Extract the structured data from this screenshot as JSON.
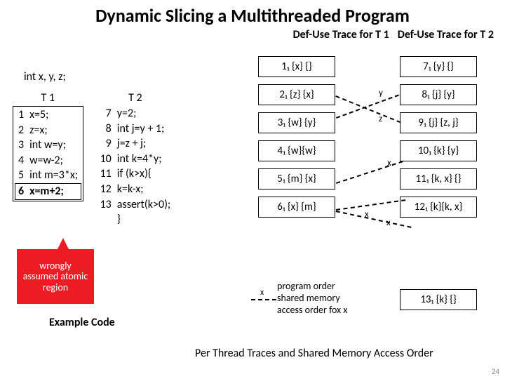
{
  "title": "Dynamic Slicing a Multithreaded Program",
  "subhead1": "Def-Use Trace for T 1",
  "subhead2": "Def-Use Trace for T 2",
  "decl": "int x, y, z;",
  "t1_title": "T 1",
  "t2_title": "T 2",
  "t1_lines": [
    {
      "n": "1",
      "c": "x=5;"
    },
    {
      "n": "2",
      "c": "z=x;"
    },
    {
      "n": "3",
      "c": "int w=y;"
    },
    {
      "n": "4",
      "c": "w=w-2;"
    },
    {
      "n": "5",
      "c": "int  m=3*x;"
    },
    {
      "n": "6",
      "c": "x=m+2;"
    }
  ],
  "t2_lines": [
    {
      "n": "7",
      "c": "y=2;"
    },
    {
      "n": "8",
      "c": "int j=y + 1;"
    },
    {
      "n": "9",
      "c": "j=z + j;"
    },
    {
      "n": "10",
      "c": "int k=4*y;"
    },
    {
      "n": "11",
      "c": "if (k>x){"
    },
    {
      "n": "12",
      "c": "    k=k-x;"
    },
    {
      "n": "13",
      "c": "   assert(k>0);"
    },
    {
      "n": "",
      "c": "   }"
    }
  ],
  "speech": "wrongly assumed atomic region",
  "example_label": "Example Code",
  "trace1": [
    "1₁  {x} {}",
    "2₁  {z} {x}",
    "3₁  {w} {y}",
    "4₁  {w}{w}",
    "5₁  {m} {x}",
    "6₁  {x} {m}"
  ],
  "trace2": [
    "7₁  {y} {}",
    "8₁  {j} {y}",
    "9₁  {j} {z, j}",
    "10₁ {k} {y}",
    "11₁ {k, x} {}",
    "12₁ {k}{k, x}"
  ],
  "trace2_extra": "13₁ {k} {}",
  "legend1": "program order",
  "legend2": "shared memory",
  "legend3": "access order fox x",
  "legend_var": "x",
  "ordernote": "Per Thread Traces and Shared Memory Access Order",
  "conn_y": "y",
  "conn_z": "z",
  "conn_x1": "x",
  "conn_x2": "x",
  "conn_x3": "x",
  "slidenum": "24"
}
